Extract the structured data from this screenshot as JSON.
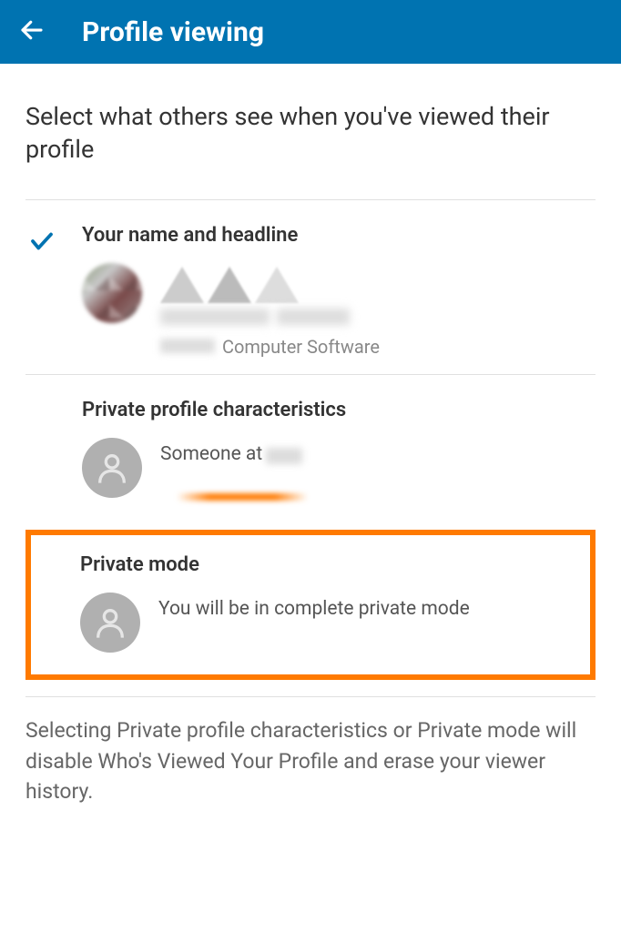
{
  "header": {
    "title": "Profile viewing"
  },
  "subtitle": "Select what others see when you've viewed their profile",
  "options": [
    {
      "title": "Your name and headline",
      "computer_software": "Computer Software",
      "selected": true
    },
    {
      "title": "Private profile characteristics",
      "desc": "Someone at"
    },
    {
      "title": "Private mode",
      "desc": "You will be in complete private mode"
    }
  ],
  "disclaimer": "Selecting Private profile characteristics or Private mode will disable Who's Viewed Your Profile and erase your viewer history."
}
